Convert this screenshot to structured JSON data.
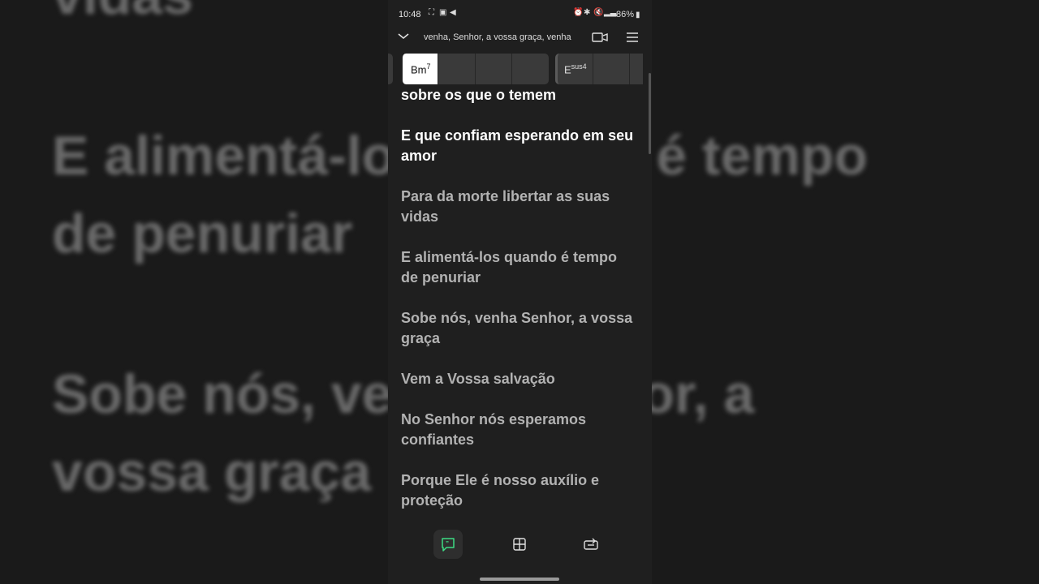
{
  "background_lyrics": [
    "vidas",
    "E alimentá-los quando é tempo",
    "de penuriar",
    "Sobe nós, venha Senhor, a",
    "vossa graça"
  ],
  "status_bar": {
    "time": "10:48",
    "battery": "86%"
  },
  "header": {
    "song_title": "venha, Senhor, a vossa graça, venha"
  },
  "chords": [
    {
      "root": "Bm",
      "modifier": "7"
    },
    {
      "root": "E",
      "modifier": "sus4"
    }
  ],
  "lyrics": [
    "sobre os que o temem",
    "E que confiam esperando em seu amor",
    "Para da morte libertar as suas vidas",
    "E alimentá-los quando é tempo de penuriar",
    "Sobe nós, venha Senhor, a vossa graça",
    "Vem a Vossa salvação",
    "No Senhor nós esperamos confiantes",
    "Porque Ele é nosso auxílio e proteção"
  ],
  "colors": {
    "accent": "#3ddc84",
    "current_line": "#ffffff",
    "inactive_line": "#b2b2b2"
  },
  "icons": {
    "nav": [
      "lyrics-icon",
      "chords-grid-icon",
      "loop-icon"
    ]
  }
}
